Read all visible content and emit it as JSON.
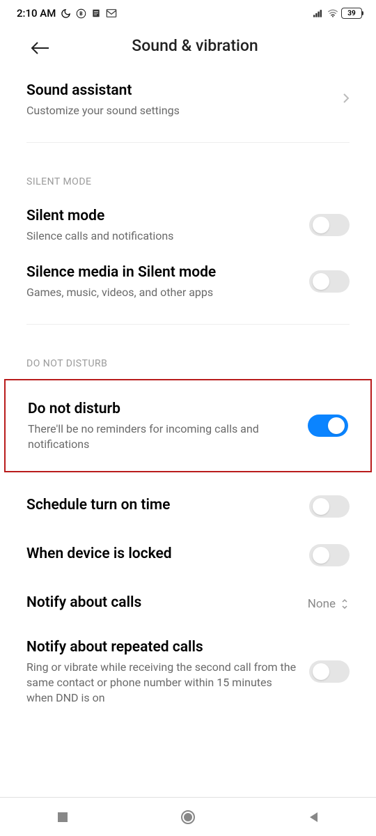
{
  "status": {
    "time": "2:10 AM",
    "battery": "39"
  },
  "header": {
    "title": "Sound & vibration"
  },
  "sound_assistant": {
    "title": "Sound assistant",
    "subtitle": "Customize your sound settings"
  },
  "sections": {
    "silent": "SILENT MODE",
    "dnd": "DO NOT DISTURB"
  },
  "silent_mode": {
    "title": "Silent mode",
    "subtitle": "Silence calls and notifications"
  },
  "silence_media": {
    "title": "Silence media in Silent mode",
    "subtitle": "Games, music, videos, and other apps"
  },
  "dnd": {
    "title": "Do not disturb",
    "subtitle": "There'll be no reminders for incoming calls and notifications"
  },
  "schedule": {
    "title": "Schedule turn on time"
  },
  "locked": {
    "title": "When device is locked"
  },
  "notify_calls": {
    "title": "Notify about calls",
    "value": "None"
  },
  "notify_repeated": {
    "title": "Notify about repeated calls",
    "subtitle": "Ring or vibrate while receiving the second call from the same contact or phone number within 15 minutes when DND is on"
  }
}
